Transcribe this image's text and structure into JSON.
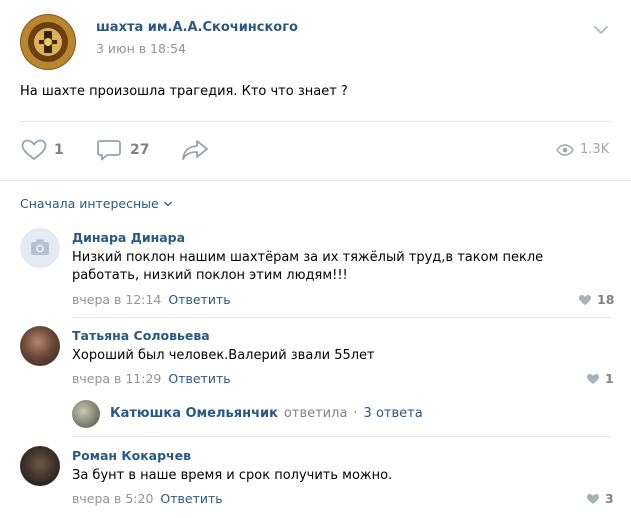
{
  "post": {
    "author": "шахта им.А.А.Скочинского",
    "date": "3 июн в 18:54",
    "text": "На шахте произошла трагедия. Кто что знает ?",
    "likes": "1",
    "comments": "27",
    "views": "1.3K"
  },
  "comments_sort": "Сначала интересные",
  "comments": [
    {
      "author": "Динара Динара",
      "text": "Низкий поклон нашим шахтёрам за их тяжёлый труд,в таком пекле работать, низкий поклон этим людям!!!",
      "time": "вчера в 12:14",
      "reply_label": "Ответить",
      "likes": "18"
    },
    {
      "author": "Татьяна Соловьева",
      "text": "Хороший был человек.Валерий звали 55лет",
      "time": "вчера в 11:29",
      "reply_label": "Ответить",
      "likes": "1",
      "thread": {
        "author": "Катюшка Омельянчик",
        "verb": "ответила",
        "separator": "·",
        "count": "3 ответа"
      }
    },
    {
      "author": "Роман Кокарчев",
      "text": "За бунт в наше время и срок получить можно.",
      "time": "вчера в 5:20",
      "reply_label": "Ответить",
      "likes": "3"
    }
  ],
  "colors": {
    "link": "#2a5885",
    "meta": "#939393",
    "divider": "#e7e8ec"
  }
}
